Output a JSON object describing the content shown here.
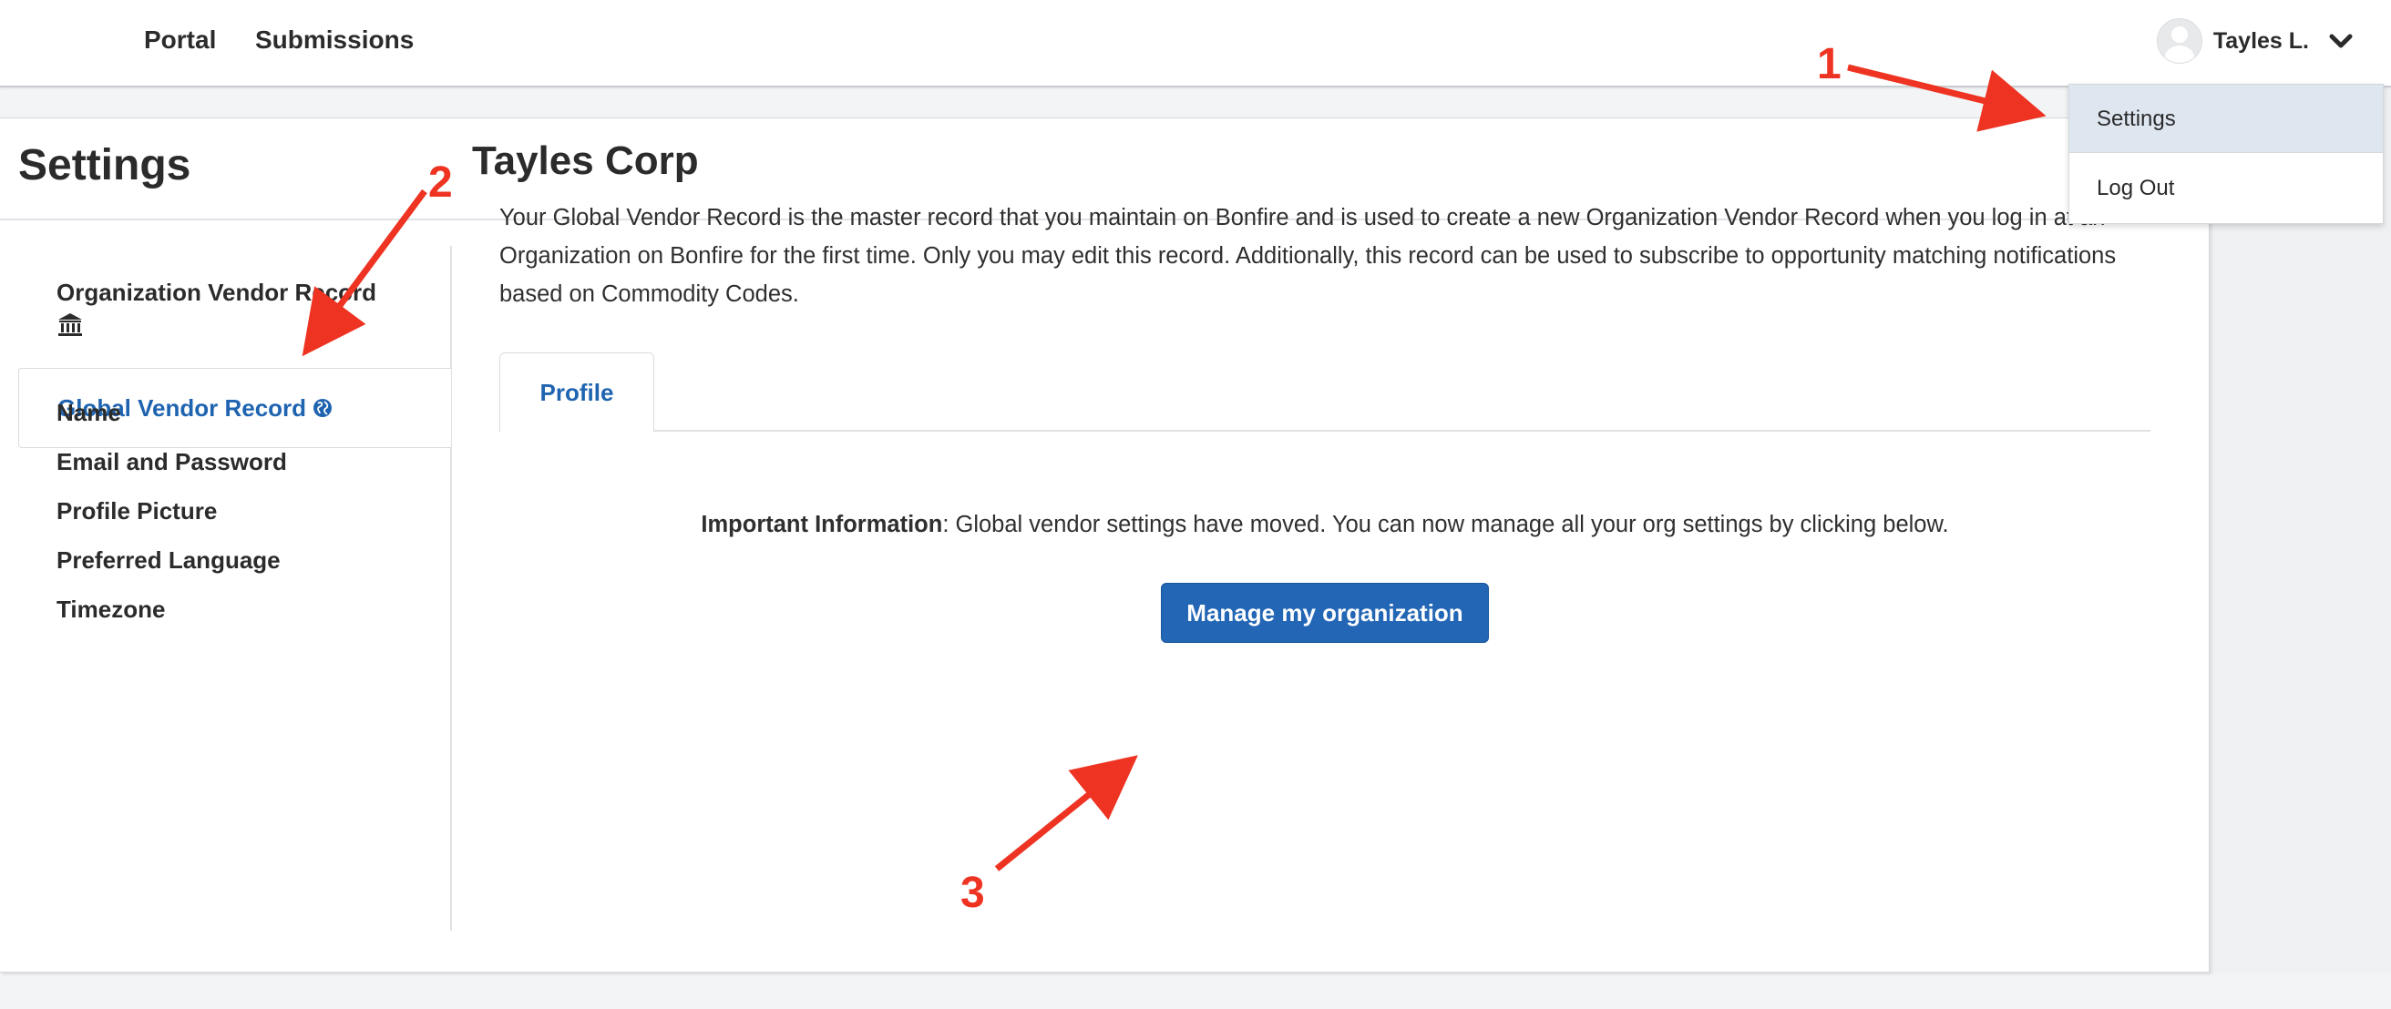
{
  "nav": {
    "portal": "Portal",
    "submissions": "Submissions"
  },
  "user": {
    "name": "Tayles L."
  },
  "dropdown": {
    "settings": "Settings",
    "logout": "Log Out"
  },
  "page": {
    "title": "Settings"
  },
  "sidebar": {
    "items": [
      "Organization Vendor Record",
      "Global Vendor Record",
      "Name",
      "Email and Password",
      "Profile Picture",
      "Preferred Language",
      "Timezone"
    ],
    "active_index": 1
  },
  "main": {
    "title": "Tayles Corp",
    "description": "Your Global Vendor Record is the master record that you maintain on Bonfire and is used to create a new Organization Vendor Record when you log in at an Organization on Bonfire for the first time. Only you may edit this record. Additionally, this record can be used to subscribe to opportunity matching notifications based on Commodity Codes.",
    "tab": "Profile",
    "info_bold": "Important Information",
    "info_text": ": Global vendor settings have moved. You can now manage all your org settings by clicking below.",
    "button": "Manage my organization"
  },
  "annotations": {
    "one": "1",
    "two": "2",
    "three": "3"
  },
  "colors": {
    "accent": "#1f64b0",
    "button": "#2266b5",
    "annotation": "#ee3322",
    "dropdown_highlight": "#dee6f0"
  },
  "icons": {
    "avatar": "user-avatar-icon",
    "chevron": "chevron-down-icon",
    "bank": "bank-icon",
    "globe": "globe-icon"
  }
}
